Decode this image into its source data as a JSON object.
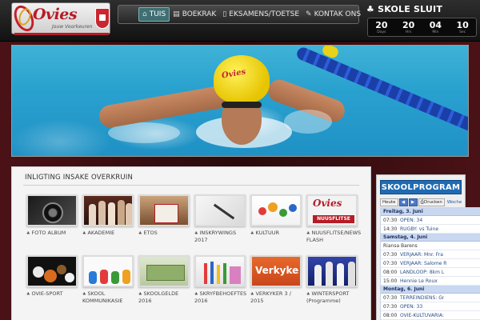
{
  "header": {
    "logo_text": "Ovies",
    "logo_sub": "Jouw Voorkeuren",
    "nav": [
      {
        "label": "TUIS",
        "icon": "home-icon",
        "glyph": "⌂",
        "active": true
      },
      {
        "label": "BOEKRAK",
        "icon": "book-icon",
        "glyph": "▤",
        "active": false
      },
      {
        "label": "EKSAMENS/TOETSE",
        "icon": "document-icon",
        "glyph": "▯",
        "active": false
      },
      {
        "label": "KONTAK ONS",
        "icon": "wrench-icon",
        "glyph": "✎",
        "active": false
      }
    ],
    "countdown_title": "SKOLE SLUIT",
    "countdown_icon": "club-icon",
    "countdown": [
      {
        "value": "20",
        "label": "Days"
      },
      {
        "value": "20",
        "label": "Hrs"
      },
      {
        "value": "04",
        "label": "Min"
      },
      {
        "value": "10",
        "label": "Sec"
      }
    ]
  },
  "hero": {
    "cap_text": "Ovies"
  },
  "content": {
    "title": "INLIGTING INSAKE OVERKRUIN",
    "tiles": [
      {
        "label": "FOTO ALBUM",
        "name": "tile-foto-album",
        "img": "img-camera"
      },
      {
        "label": "AKADEMIE",
        "name": "tile-akademie",
        "img": "img-akademie"
      },
      {
        "label": "ETOS",
        "name": "tile-etos",
        "img": "img-etos"
      },
      {
        "label": "INSKRYWINGS 2017",
        "name": "tile-inskrywings",
        "img": "img-inskrywings"
      },
      {
        "label": "KULTUUR",
        "name": "tile-kultuur",
        "img": "img-kultuur"
      },
      {
        "label": "NUUSFLITSE/NEWS FLASH",
        "name": "tile-nuusflitse",
        "img": "img-nuus"
      },
      {
        "label": "OVIE-SPORT",
        "name": "tile-ovie-sport",
        "img": "img-oviesport"
      },
      {
        "label": "SKOOL KOMMUNIKASIE",
        "name": "tile-skool-kommunikasie",
        "img": "img-kommunikasie"
      },
      {
        "label": "SKOOLGELDE 2016",
        "name": "tile-skoolgelde",
        "img": "img-skoolgelde"
      },
      {
        "label": "SKRYFBEHOEFTES 2016",
        "name": "tile-skryfbehoeftes",
        "img": "img-skryf"
      },
      {
        "label": "VERKYKER 3 / 2015",
        "name": "tile-verkyker",
        "img": "img-verkyker"
      },
      {
        "label": "WINTERSPORT (Programme)",
        "name": "tile-wintersport",
        "img": "img-winter"
      }
    ],
    "nuus_logo": "Ovies",
    "nuus_banner": "NUUSFLITSE",
    "verkyker_text": "Verkyke"
  },
  "sidebar": {
    "title": "SKOOLPROGRAM",
    "today_label": "Heute",
    "print_label": "Drucken",
    "week_label": "Woche",
    "prev_glyph": "◀",
    "next_glyph": "▶",
    "days": [
      {
        "label": "Freitag, 3. Juni",
        "events": [
          {
            "time": "07:30",
            "text": "OPEN: 34"
          },
          {
            "time": "14:30",
            "text": "RUGBY: vs Tuine"
          }
        ]
      },
      {
        "label": "Samstag, 4. Juni",
        "events": [
          {
            "time": "",
            "text": "Riansa Barens"
          },
          {
            "time": "07:30",
            "text": "VERJAAR: Mnr. Fra"
          },
          {
            "time": "07:30",
            "text": "VERJAAR: Salome R"
          },
          {
            "time": "08:00",
            "text": "LANDLOOP: 8km L"
          },
          {
            "time": "15:00",
            "text": "Hennie Le Roux"
          }
        ]
      },
      {
        "label": "Montag, 6. Juni",
        "events": [
          {
            "time": "07:30",
            "text": "TERREINDIENS: Gr"
          },
          {
            "time": "07:30",
            "text": "OPEN: 33"
          },
          {
            "time": "08:00",
            "text": "OVIE-KULTUVARIA:"
          }
        ]
      }
    ]
  }
}
